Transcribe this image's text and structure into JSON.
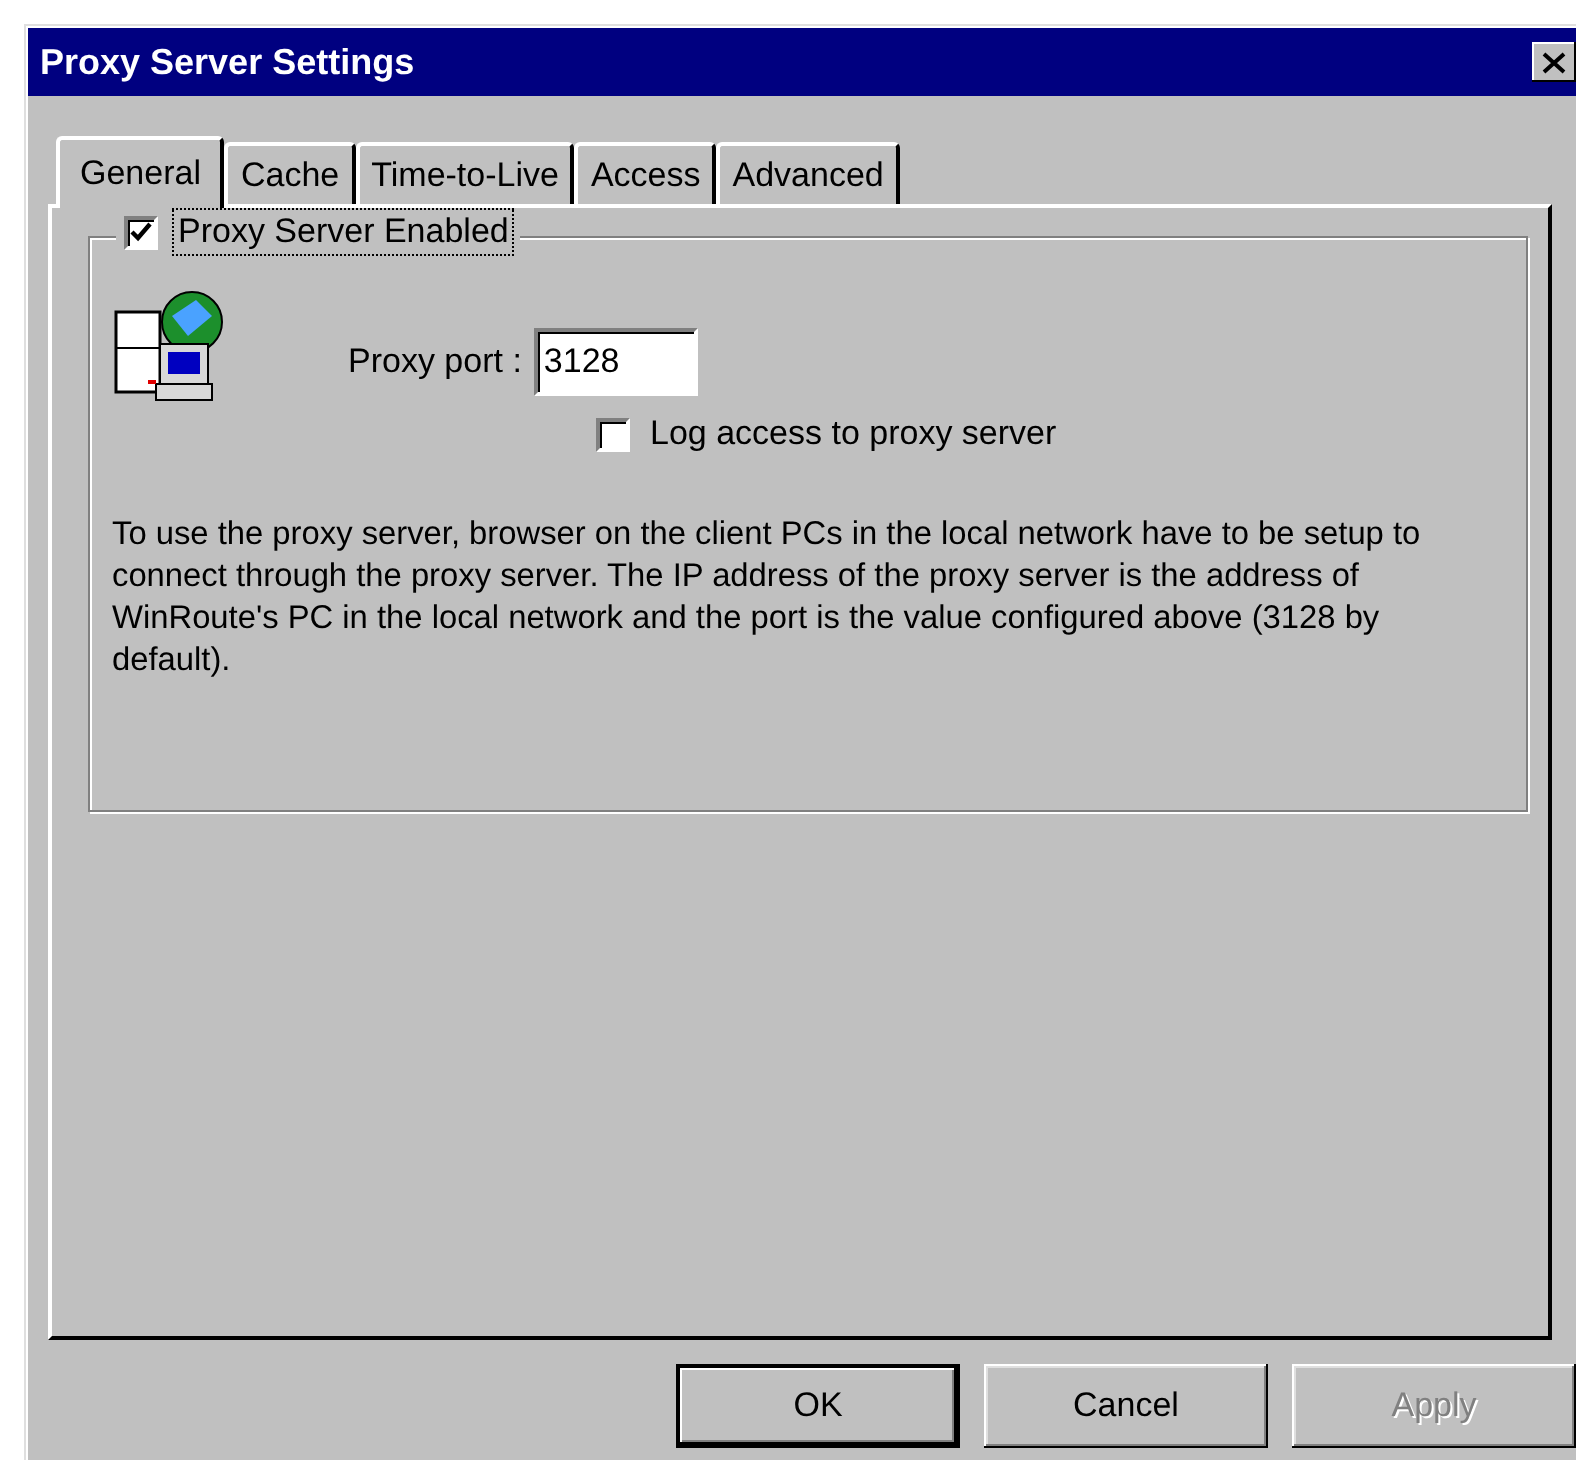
{
  "window": {
    "title": "Proxy Server Settings"
  },
  "tabs": [
    {
      "label": "General",
      "selected": true
    },
    {
      "label": "Cache",
      "selected": false
    },
    {
      "label": "Time-to-Live",
      "selected": false
    },
    {
      "label": "Access",
      "selected": false
    },
    {
      "label": "Advanced",
      "selected": false
    }
  ],
  "proxy_enabled": {
    "label": "Proxy Server Enabled",
    "checked": true
  },
  "proxy_port": {
    "label": "Proxy port :",
    "value": "3128"
  },
  "log_access": {
    "label": "Log access to proxy server",
    "checked": false
  },
  "description": "To use the proxy server, browser on the client PCs in the local network have to be setup to connect through the proxy server. The IP address of the proxy server is the address of WinRoute's PC in the local network and the port is the value configured above (3128 by default).",
  "buttons": [
    {
      "label": "OK",
      "default": true,
      "disabled": false
    },
    {
      "label": "Cancel",
      "default": false,
      "disabled": false
    },
    {
      "label": "Apply",
      "default": false,
      "disabled": true
    }
  ]
}
